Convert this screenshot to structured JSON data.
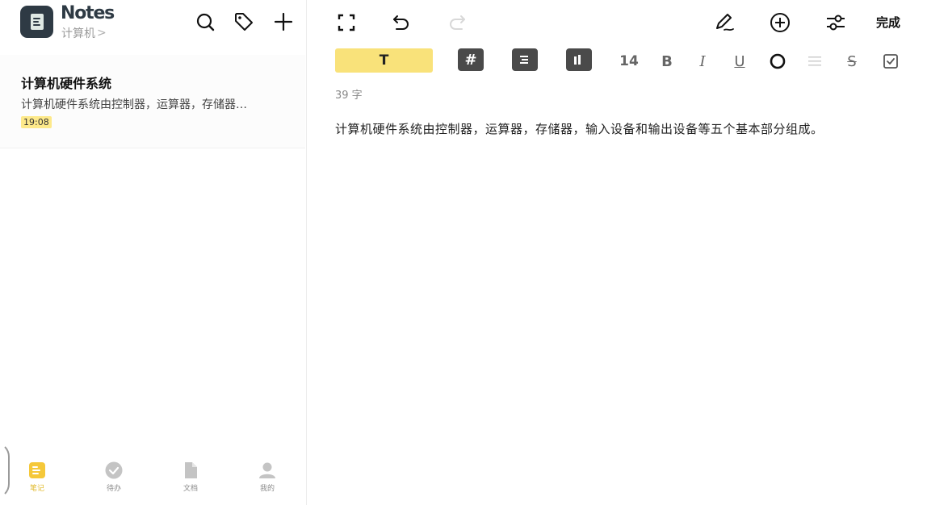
{
  "app": {
    "title": "Notes",
    "folder": "计算机",
    "folder_chevron": ">"
  },
  "header_icons": [
    "search-icon",
    "tag-icon",
    "plus-icon"
  ],
  "note_list": [
    {
      "title": "计算机硬件系统",
      "preview": "计算机硬件系统由控制器，运算器，存储器…",
      "time": "19:08"
    }
  ],
  "bottom_nav": [
    {
      "label": "笔记",
      "icon": "note-icon",
      "active": true
    },
    {
      "label": "待办",
      "icon": "check-circle-icon",
      "active": false
    },
    {
      "label": "文档",
      "icon": "document-icon",
      "active": false
    },
    {
      "label": "我的",
      "icon": "person-icon",
      "active": false
    }
  ],
  "editor": {
    "toolbar_icons": [
      "fullscreen-icon",
      "undo-icon",
      "redo-icon",
      "pen-icon",
      "add-circle-icon",
      "adjust-icon"
    ],
    "done_label": "完成",
    "format": {
      "text_style_label": "T",
      "heading_label": "#",
      "font_size": "14",
      "bold": "B",
      "italic": "I",
      "underline": "U",
      "strike": "S"
    },
    "word_count": "39 字",
    "body": "计算机硬件系统由控制器，运算器，存储器，输入设备和输出设备等五个基本部分组成。"
  },
  "colors": {
    "accent_yellow": "#f9e27a",
    "time_badge": "#fde98a",
    "logo_bg": "#2e3a44",
    "nav_active": "#e0b92a"
  }
}
